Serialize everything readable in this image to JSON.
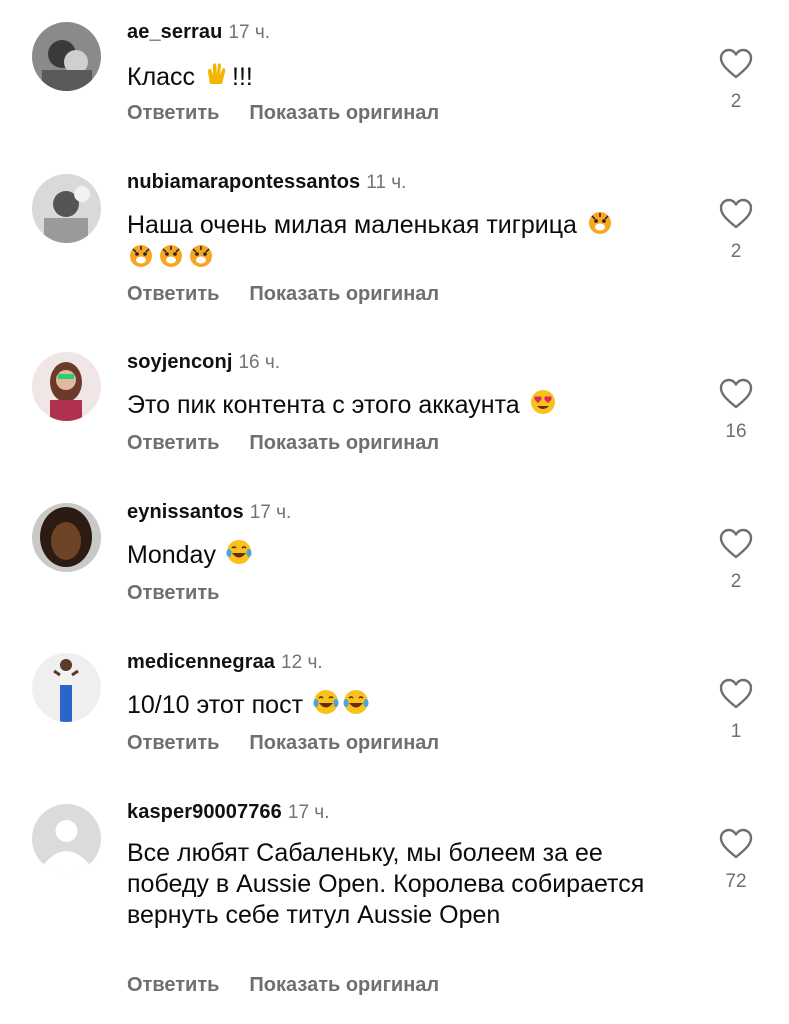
{
  "comments": [
    {
      "username": "ae_serrau",
      "time": "17 ч.",
      "text": "Класс",
      "text_suffix": "!!!",
      "emoji": "raised-hands-icon",
      "reply": "Ответить",
      "translate": "Показать оригинал",
      "likes": "2"
    },
    {
      "username": "nubiamarapontessantos",
      "time": "11 ч.",
      "text": "Наша очень милая маленькая тигрица",
      "emoji": "tiger-face-icon",
      "reply": "Ответить",
      "translate": "Показать оригинал",
      "likes": "2"
    },
    {
      "username": "soyjenconj",
      "time": "16 ч.",
      "text": "Это пик контента с этого аккаунта",
      "emoji": "heart-eyes-icon",
      "reply": "Ответить",
      "translate": "Показать оригинал",
      "likes": "16"
    },
    {
      "username": "eynissantos",
      "time": "17 ч.",
      "text": "Monday",
      "emoji": "tears-of-joy-icon",
      "reply": "Ответить",
      "likes": "2"
    },
    {
      "username": "medicennegraa",
      "time": "12 ч.",
      "text": "10/10 этот пост",
      "emoji": "tears-of-joy-icon",
      "reply": "Ответить",
      "translate": "Показать оригинал",
      "likes": "1"
    },
    {
      "username": "kasper90007766",
      "time": "17 ч.",
      "text": "Все любят Сабаленьку, мы болеем за ее победу в Aussie Open. Королева собирается вернуть себе титул Aussie Open",
      "reply": "Ответить",
      "translate": "Показать оригинал",
      "likes": "72"
    }
  ],
  "colors": {
    "muted": "#6f6f6f",
    "time": "#737373",
    "text": "#0b0b0b",
    "placeholder_avatar": "#dbdbdb"
  }
}
